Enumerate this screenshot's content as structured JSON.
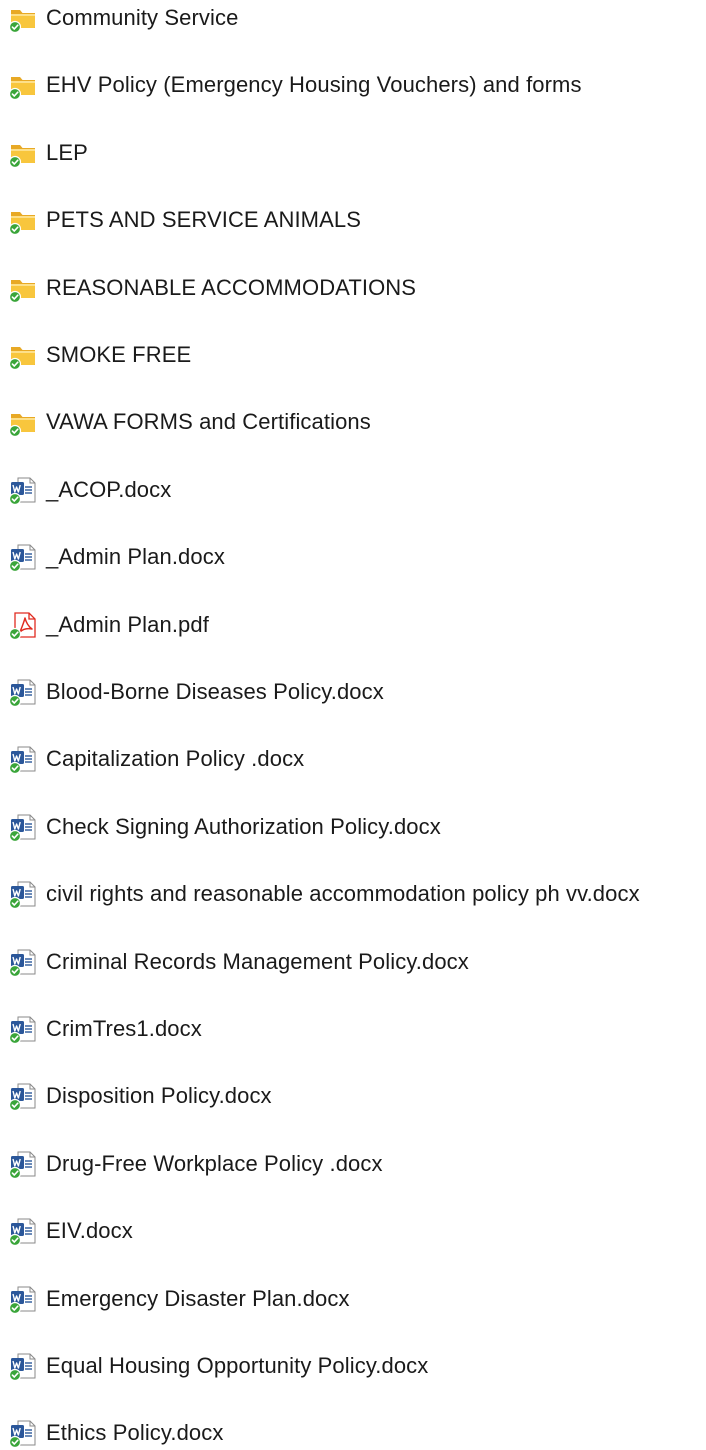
{
  "items": [
    {
      "name": "Community Service",
      "type": "folder"
    },
    {
      "name": "EHV Policy (Emergency Housing Vouchers) and forms",
      "type": "folder"
    },
    {
      "name": "LEP",
      "type": "folder"
    },
    {
      "name": "PETS AND SERVICE ANIMALS",
      "type": "folder"
    },
    {
      "name": "REASONABLE ACCOMMODATIONS",
      "type": "folder"
    },
    {
      "name": "SMOKE FREE",
      "type": "folder"
    },
    {
      "name": "VAWA FORMS and Certifications",
      "type": "folder"
    },
    {
      "name": "_ACOP.docx",
      "type": "word"
    },
    {
      "name": "_Admin Plan.docx",
      "type": "word"
    },
    {
      "name": "_Admin Plan.pdf",
      "type": "pdf"
    },
    {
      "name": "Blood-Borne Diseases Policy.docx",
      "type": "word"
    },
    {
      "name": "Capitalization Policy .docx",
      "type": "word"
    },
    {
      "name": "Check Signing Authorization Policy.docx",
      "type": "word"
    },
    {
      "name": "civil rights and reasonable accommodation policy ph vv.docx",
      "type": "word"
    },
    {
      "name": "Criminal Records Management Policy.docx",
      "type": "word"
    },
    {
      "name": "CrimTres1.docx",
      "type": "word"
    },
    {
      "name": "Disposition Policy.docx",
      "type": "word"
    },
    {
      "name": "Drug-Free Workplace Policy .docx",
      "type": "word"
    },
    {
      "name": "EIV.docx",
      "type": "word"
    },
    {
      "name": "Emergency Disaster Plan.docx",
      "type": "word"
    },
    {
      "name": "Equal Housing Opportunity Policy.docx",
      "type": "word"
    },
    {
      "name": "Ethics Policy.docx",
      "type": "word"
    }
  ],
  "icons": {
    "folder": "folder-icon",
    "word": "word-document-icon",
    "pdf": "pdf-document-icon",
    "sync": "sync-status-check-icon"
  },
  "colors": {
    "folder": "#f8c63d",
    "word_blue": "#2b579a",
    "pdf_red": "#e02b20",
    "sync_green": "#3aa53a"
  }
}
